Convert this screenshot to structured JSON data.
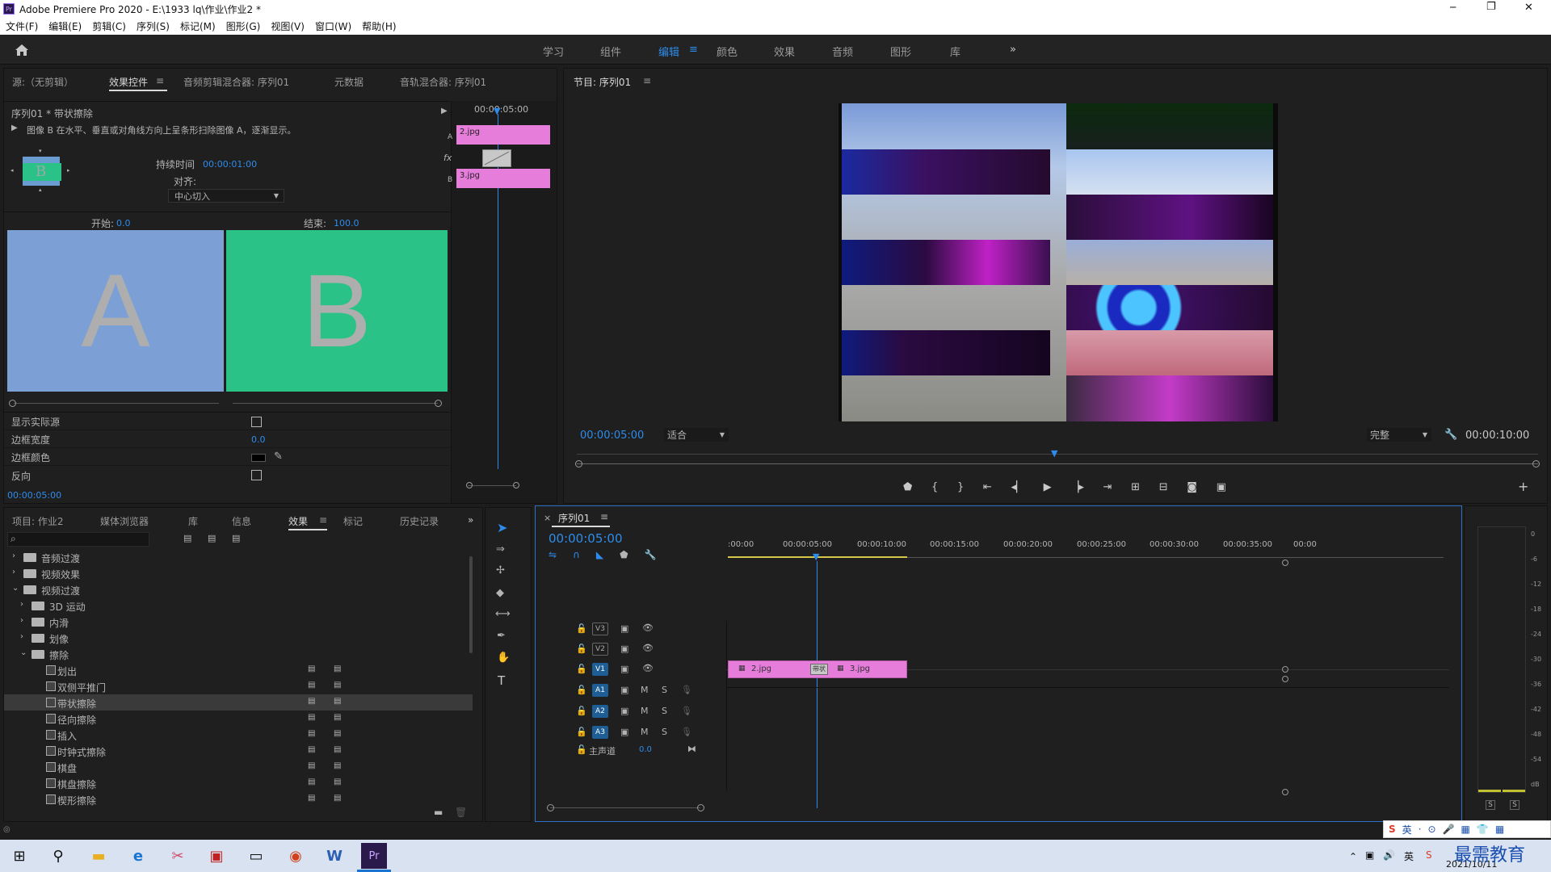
{
  "titlebar": {
    "app_icon": "Pr",
    "title": "Adobe Premiere Pro 2020 - E:\\1933 lq\\作业\\作业2 *",
    "minimize": "─",
    "restore": "❐",
    "close": "✕"
  },
  "menu": [
    "文件(F)",
    "编辑(E)",
    "剪辑(C)",
    "序列(S)",
    "标记(M)",
    "图形(G)",
    "视图(V)",
    "窗口(W)",
    "帮助(H)"
  ],
  "workspaces": [
    "学习",
    "组件",
    "编辑",
    "颜色",
    "效果",
    "音频",
    "图形",
    "库"
  ],
  "workspace_active": "编辑",
  "workspace_menu_glyph": "≡",
  "workspace_more": "»",
  "source_panel": {
    "tabs": [
      "源:（无剪辑）",
      "效果控件",
      "音频剪辑混合器: 序列01",
      "元数据",
      "音轨混合器: 序列01"
    ],
    "active_tab": "效果控件",
    "menu_glyph": "≡",
    "clip_path": "序列01 * 带状擦除",
    "description": "图像 B 在水平、垂直或对角线方向上呈条形扫除图像 A，逐渐显示。",
    "thumb_letter": "B",
    "duration_label": "持续时间",
    "duration_value": "00:00:01:00",
    "align_label": "对齐:",
    "align_value": "中心切入",
    "start_label": "开始:",
    "start_value": "0.0",
    "end_label": "结束:",
    "end_value": "100.0",
    "preview_a": "A",
    "preview_b": "B",
    "a_color": "#7c9fd5",
    "b_color": "#2ac286",
    "params": [
      {
        "label": "显示实际源",
        "type": "checkbox"
      },
      {
        "label": "边框宽度",
        "type": "value",
        "value": "0.0"
      },
      {
        "label": "边框颜色",
        "type": "color"
      },
      {
        "label": "反向",
        "type": "checkbox"
      }
    ],
    "mini_timecode": "00:00:05:00",
    "mini_ruler": "00:00:05:00",
    "clip_a": "2.jpg",
    "clip_b": "3.jpg",
    "track_a": "A",
    "track_b": "B",
    "fx_label": "fx",
    "timecode_bottom": "00:00:05:00"
  },
  "program": {
    "title": "节目: 序列01",
    "menu_glyph": "≡",
    "timecode": "00:00:05:00",
    "fit": "适合",
    "quality": "完整",
    "duration": "00:00:10:00",
    "controls": [
      "marker",
      "in",
      "out",
      "go-in",
      "step-back",
      "play",
      "step-forward",
      "go-out",
      "lift",
      "extract",
      "export-frame",
      "compare"
    ],
    "add": "+"
  },
  "project": {
    "tabs": [
      "项目: 作业2",
      "媒体浏览器",
      "库",
      "信息",
      "效果",
      "标记",
      "历史记录"
    ],
    "active_tab": "效果",
    "menu_glyph": "≡",
    "more": "»",
    "search_icon": "⌕",
    "tree": [
      {
        "label": "音频过渡",
        "level": 0,
        "kind": "folder",
        "open": false
      },
      {
        "label": "视频效果",
        "level": 0,
        "kind": "folder",
        "open": false
      },
      {
        "label": "视频过渡",
        "level": 0,
        "kind": "folder",
        "open": true
      },
      {
        "label": "3D 运动",
        "level": 1,
        "kind": "folder",
        "open": false
      },
      {
        "label": "内滑",
        "level": 1,
        "kind": "folder",
        "open": false
      },
      {
        "label": "划像",
        "level": 1,
        "kind": "folder",
        "open": false
      },
      {
        "label": "擦除",
        "level": 1,
        "kind": "folder",
        "open": true
      },
      {
        "label": "划出",
        "level": 2,
        "kind": "item",
        "badges": 2
      },
      {
        "label": "双侧平推门",
        "level": 2,
        "kind": "item",
        "badges": 2
      },
      {
        "label": "带状擦除",
        "level": 2,
        "kind": "item",
        "badges": 2,
        "selected": true
      },
      {
        "label": "径向擦除",
        "level": 2,
        "kind": "item",
        "badges": 2
      },
      {
        "label": "插入",
        "level": 2,
        "kind": "item",
        "badges": 2
      },
      {
        "label": "时钟式擦除",
        "level": 2,
        "kind": "item",
        "badges": 2
      },
      {
        "label": "棋盘",
        "level": 2,
        "kind": "item",
        "badges": 2
      },
      {
        "label": "棋盘擦除",
        "level": 2,
        "kind": "item",
        "badges": 2
      },
      {
        "label": "楔形擦除",
        "level": 2,
        "kind": "item",
        "badges": 2
      }
    ]
  },
  "timeline": {
    "close": "×",
    "title": "序列01",
    "menu_glyph": "≡",
    "timecode": "00:00:05:00",
    "ruler": [
      ":00:00",
      "00:00:05:00",
      "00:00:10:00",
      "00:00:15:00",
      "00:00:20:00",
      "00:00:25:00",
      "00:00:30:00",
      "00:00:35:00",
      "00:00"
    ],
    "tracks": [
      {
        "name": "V3",
        "kind": "video"
      },
      {
        "name": "V2",
        "kind": "video"
      },
      {
        "name": "V1",
        "kind": "video",
        "target": true
      },
      {
        "name": "A1",
        "kind": "audio",
        "target": true
      },
      {
        "name": "A2",
        "kind": "audio",
        "target": true
      },
      {
        "name": "A3",
        "kind": "audio",
        "target": true
      }
    ],
    "master_label": "主声道",
    "master_value": "0.0",
    "clips": [
      "2.jpg",
      "3.jpg"
    ],
    "transition_label": "带状"
  },
  "audio_meter": {
    "scale": [
      "0",
      "-6",
      "-12",
      "-18",
      "-24",
      "-30",
      "-36",
      "-42",
      "-48",
      "-54",
      "dB"
    ],
    "solo": [
      "S",
      "S"
    ]
  },
  "taskbar": {
    "apps": [
      "windows-logo",
      "search",
      "file-explorer",
      "edge",
      "snip",
      "teams",
      "terminal",
      "chrome",
      "word",
      "premiere"
    ],
    "ime": [
      "英",
      "·",
      "⊙",
      "🎤",
      "▦",
      "👕",
      "▦"
    ],
    "date": "2021/10/11",
    "watermark": "最需教育"
  }
}
